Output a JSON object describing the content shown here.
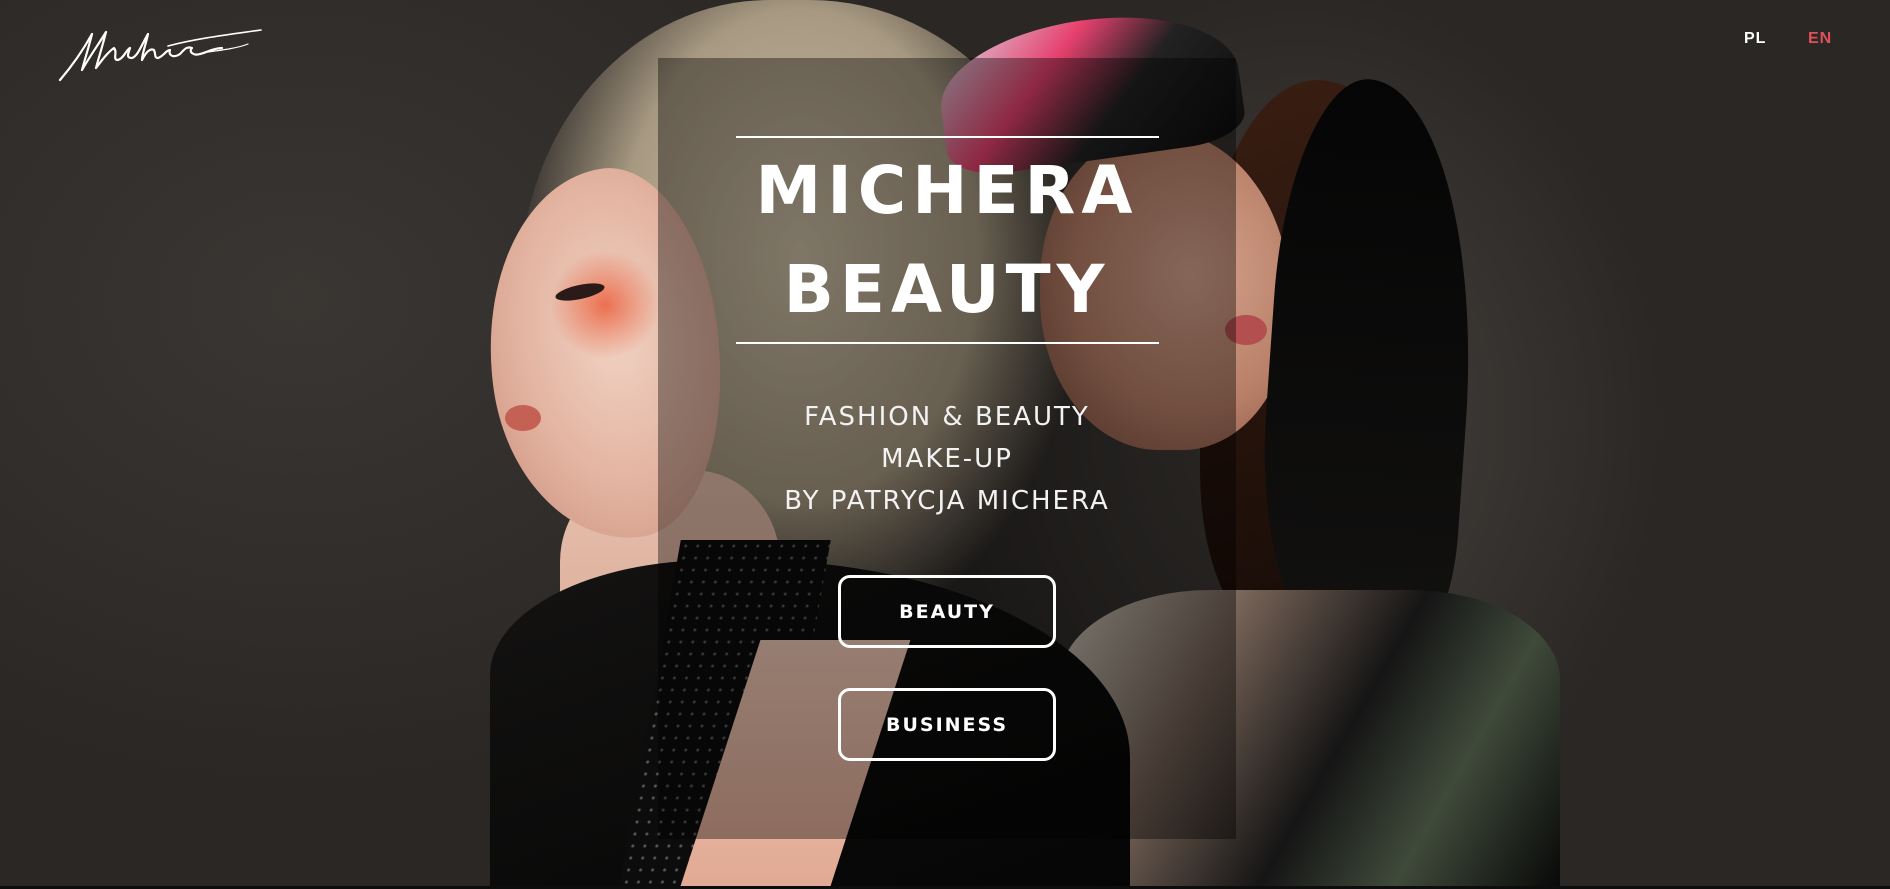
{
  "header": {
    "logo_text": "Michera",
    "languages": [
      {
        "code": "PL",
        "active": false
      },
      {
        "code": "EN",
        "active": true
      }
    ],
    "active_language_color": "#e0505a"
  },
  "hero": {
    "title_line_1": "MICHERA",
    "title_line_2": "BEAUTY",
    "subtitle_lines": [
      "FASHION & BEAUTY",
      "MAKE-UP",
      "BY PATRYCJA MICHERA"
    ],
    "buttons": [
      {
        "label": "BEAUTY"
      },
      {
        "label": "BUSINESS"
      }
    ]
  },
  "colors": {
    "background": "#2a2826",
    "text": "#ffffff",
    "accent": "#e0505a"
  }
}
